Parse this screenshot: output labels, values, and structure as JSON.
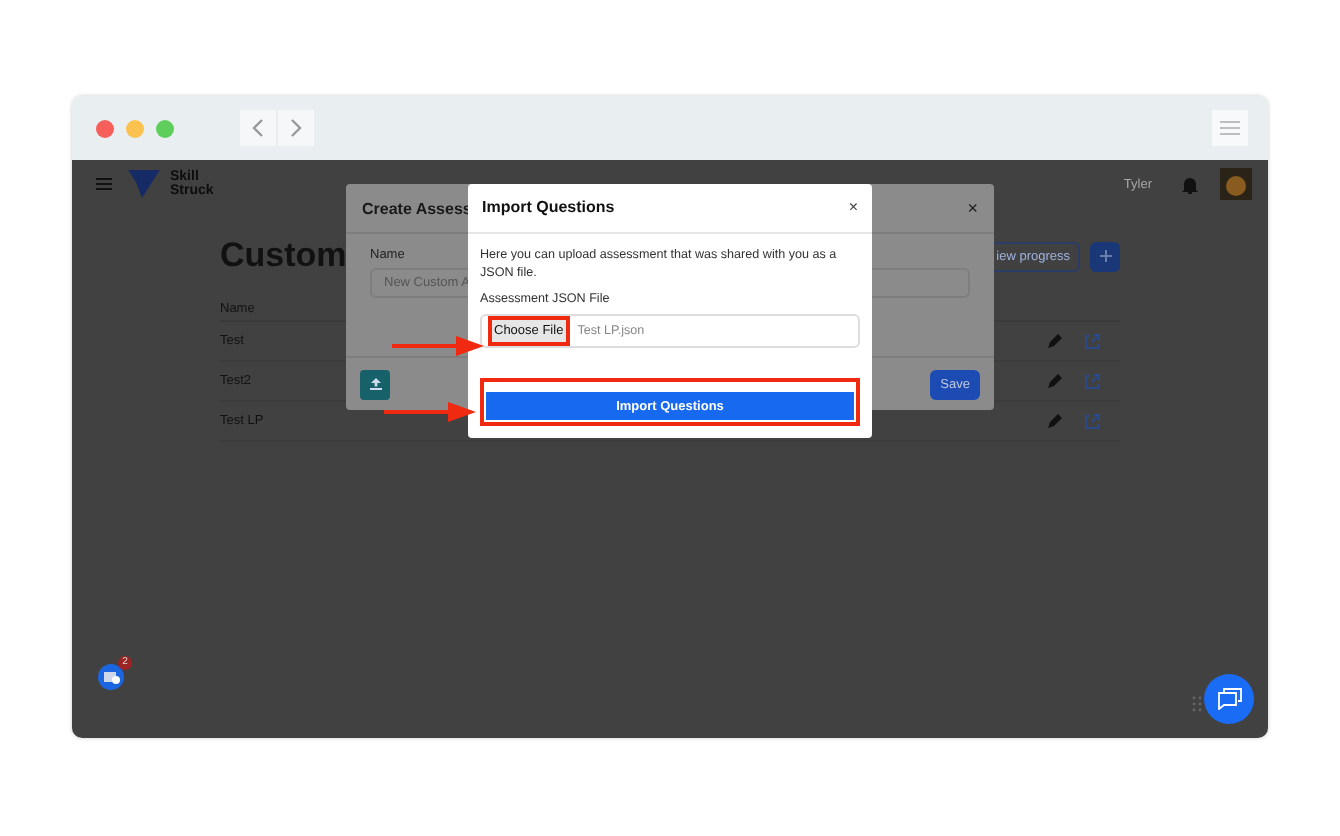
{
  "app": {
    "brand": [
      "Skill",
      "Struck"
    ],
    "user": "Tyler",
    "heading": "Custom",
    "view_progress": "iew progress",
    "table": {
      "columns": [
        "Name"
      ],
      "rows": [
        {
          "name": "Test"
        },
        {
          "name": "Test2"
        },
        {
          "name": "Test LP"
        }
      ]
    },
    "widget_badge": "2"
  },
  "create_modal": {
    "title": "Create Assess",
    "name_label": "Name",
    "name_placeholder": "New Custom A",
    "save": "Save"
  },
  "import_modal": {
    "title": "Import Questions",
    "close": "×",
    "description": "Here you can upload assessment that was shared with you as a JSON file.",
    "file_label": "Assessment JSON File",
    "choose_button": "Choose File",
    "file_name": "Test LP.json",
    "submit": "Import Questions"
  },
  "create_close": "×"
}
